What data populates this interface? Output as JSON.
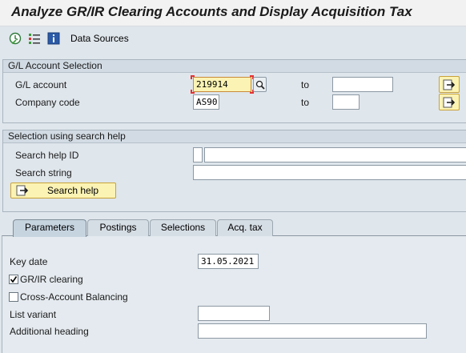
{
  "window": {
    "title": "Analyze GR/IR Clearing Accounts and Display Acquisition Tax"
  },
  "toolbar": {
    "execute_icon": "execute-clock-icon",
    "variants_icon": "variants-list-icon",
    "info_icon": "info-icon",
    "data_sources_label": "Data Sources"
  },
  "gl_selection": {
    "header": "G/L Account Selection",
    "gl_account": {
      "label": "G/L account",
      "value": "219914",
      "to_label": "to",
      "to_value": ""
    },
    "company_code": {
      "label": "Company code",
      "value": "AS90",
      "to_label": "to",
      "to_value": ""
    }
  },
  "search_help": {
    "header": "Selection using search help",
    "id_label": "Search help ID",
    "id_value": "",
    "string_label": "Search string",
    "string_value": "",
    "button_label": "Search help"
  },
  "tabs": [
    {
      "label": "Parameters",
      "active": true
    },
    {
      "label": "Postings",
      "active": false
    },
    {
      "label": "Selections",
      "active": false
    },
    {
      "label": "Acq. tax",
      "active": false
    }
  ],
  "parameters": {
    "key_date_label": "Key date",
    "key_date_value": "31.05.2021",
    "grir_clearing_label": "GR/IR clearing",
    "grir_clearing_checked": true,
    "cross_account_label": "Cross-Account Balancing",
    "cross_account_checked": false,
    "list_variant_label": "List variant",
    "list_variant_value": "",
    "additional_heading_label": "Additional heading",
    "additional_heading_value": ""
  },
  "colors": {
    "background": "#dfe6ec",
    "highlight_field": "#fbf3b3",
    "focus_corner": "#e53030",
    "group_header": "#d2dbe3"
  }
}
